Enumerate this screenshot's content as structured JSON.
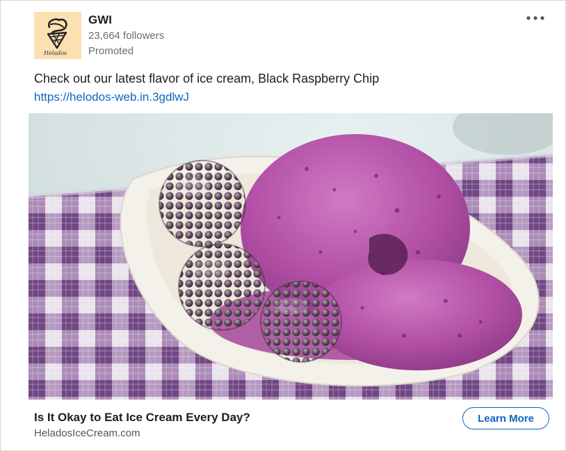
{
  "company": {
    "name": "GWI",
    "followers": "23,664 followers",
    "promoted_label": "Promoted",
    "logo_icon": "ice-cream-cone-icon",
    "logo_text": "Helados",
    "logo_background": "#fbe0b2"
  },
  "menu": {
    "icon": "more-horizontal-icon"
  },
  "post": {
    "text": "Check out our latest flavor of ice cream, Black Raspberry Chip",
    "link": "https://helodos-web.in.3gdlwJ"
  },
  "ad": {
    "image_subject": "purple ice cream scoops with blackberries in a white bowl on a checkered cloth",
    "headline": "Is It Okay to Eat Ice Cream Every Day?",
    "domain": "HeladosIceCream.com",
    "cta_label": "Learn More"
  },
  "colors": {
    "link": "#0a66c2",
    "text_primary": "#1d1d1d",
    "text_secondary": "#6c6c6c",
    "ice_cream": "#b14fa4",
    "cloth": "#7a4f8e"
  }
}
